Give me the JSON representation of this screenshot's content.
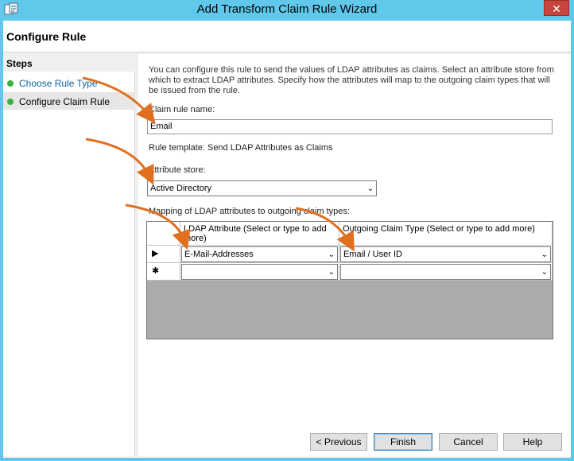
{
  "window": {
    "title": "Add Transform Claim Rule Wizard",
    "close_glyph": "✕"
  },
  "header": {
    "heading": "Configure Rule"
  },
  "steps": {
    "title": "Steps",
    "items": [
      {
        "label": "Choose Rule Type"
      },
      {
        "label": "Configure Claim Rule"
      }
    ]
  },
  "content": {
    "description": "You can configure this rule to send the values of LDAP attributes as claims. Select an attribute store from which to extract LDAP attributes. Specify how the attributes will map to the outgoing claim types that will be issued from the rule.",
    "claim_rule_name_label": "Claim rule name:",
    "claim_rule_name_value": "Email",
    "rule_template_text": "Rule template: Send LDAP Attributes as Claims",
    "attribute_store_label": "Attribute store:",
    "attribute_store_value": "Active Directory",
    "mapping_label": "Mapping of LDAP attributes to outgoing claim types:",
    "grid": {
      "columns": [
        "LDAP Attribute (Select or type to add more)",
        "Outgoing Claim Type (Select or type to add more)"
      ],
      "rows": [
        {
          "marker": "▶",
          "ldap": "E-Mail-Addresses",
          "claim": "Email / User ID"
        },
        {
          "marker": "✱",
          "ldap": "",
          "claim": ""
        }
      ]
    }
  },
  "footer": {
    "previous": "< Previous",
    "finish": "Finish",
    "cancel": "Cancel",
    "help": "Help"
  },
  "colors": {
    "titlebar": "#5fc8eb",
    "close": "#c7453d",
    "step_dot": "#3cb043",
    "annotation_arrow": "#e07020"
  }
}
